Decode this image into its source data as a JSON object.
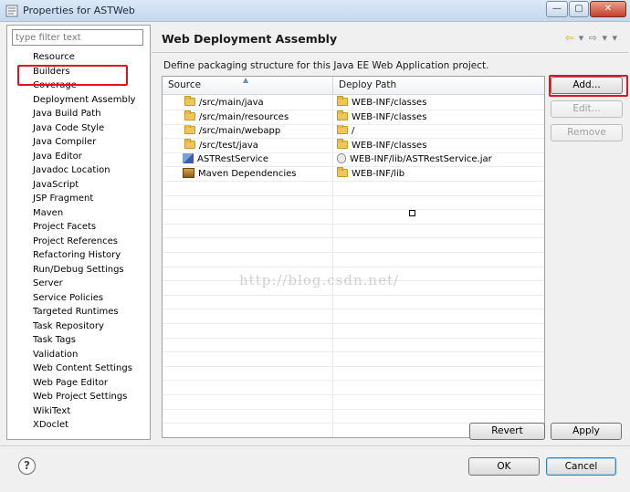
{
  "window": {
    "title": "Properties for ASTWeb",
    "minimize_glyph": "—",
    "maximize_glyph": "▢",
    "close_glyph": "✕"
  },
  "sidebar": {
    "filter_placeholder": "type filter text",
    "items": [
      {
        "label": "Resource"
      },
      {
        "label": "Builders"
      },
      {
        "label": "Coverage"
      },
      {
        "label": "Deployment Assembly",
        "selected": true
      },
      {
        "label": "Java Build Path"
      },
      {
        "label": "Java Code Style"
      },
      {
        "label": "Java Compiler"
      },
      {
        "label": "Java Editor"
      },
      {
        "label": "Javadoc Location"
      },
      {
        "label": "JavaScript"
      },
      {
        "label": "JSP Fragment"
      },
      {
        "label": "Maven"
      },
      {
        "label": "Project Facets"
      },
      {
        "label": "Project References"
      },
      {
        "label": "Refactoring History"
      },
      {
        "label": "Run/Debug Settings"
      },
      {
        "label": "Server"
      },
      {
        "label": "Service Policies"
      },
      {
        "label": "Targeted Runtimes"
      },
      {
        "label": "Task Repository"
      },
      {
        "label": "Task Tags"
      },
      {
        "label": "Validation"
      },
      {
        "label": "Web Content Settings"
      },
      {
        "label": "Web Page Editor"
      },
      {
        "label": "Web Project Settings"
      },
      {
        "label": "WikiText"
      },
      {
        "label": "XDoclet"
      }
    ]
  },
  "main": {
    "title": "Web Deployment Assembly",
    "nav": {
      "back": "⇦",
      "back_menu": "▾",
      "forward": "⇨",
      "forward_menu": "▾",
      "view_menu": "▾"
    },
    "description": "Define packaging structure for this Java EE Web Application project.",
    "table": {
      "columns": [
        "Source",
        "Deploy Path"
      ],
      "rows": [
        {
          "source": "/src/main/java",
          "deploy": "WEB-INF/classes",
          "source_icon": "folder-icon",
          "deploy_icon": "folder-icon"
        },
        {
          "source": "/src/main/resources",
          "deploy": "WEB-INF/classes",
          "source_icon": "folder-icon",
          "deploy_icon": "folder-icon"
        },
        {
          "source": "/src/main/webapp",
          "deploy": "/",
          "source_icon": "folder-icon",
          "deploy_icon": "folder-icon"
        },
        {
          "source": "/src/test/java",
          "deploy": "WEB-INF/classes",
          "source_icon": "folder-icon",
          "deploy_icon": "folder-icon"
        },
        {
          "source": "ASTRestService",
          "deploy": "WEB-INF/lib/ASTRestService.jar",
          "source_icon": "project-icon",
          "deploy_icon": "jar-icon"
        },
        {
          "source": "Maven Dependencies",
          "deploy": "WEB-INF/lib",
          "source_icon": "maven-library-icon",
          "deploy_icon": "folder-icon"
        }
      ]
    },
    "watermark": "http://blog.csdn.net/",
    "buttons": {
      "add": "Add...",
      "edit": "Edit...",
      "remove": "Remove",
      "revert": "Revert",
      "apply": "Apply"
    }
  },
  "footer": {
    "help_glyph": "?",
    "ok": "OK",
    "cancel": "Cancel"
  },
  "colors": {
    "highlight_annotation": "#e0141e"
  }
}
